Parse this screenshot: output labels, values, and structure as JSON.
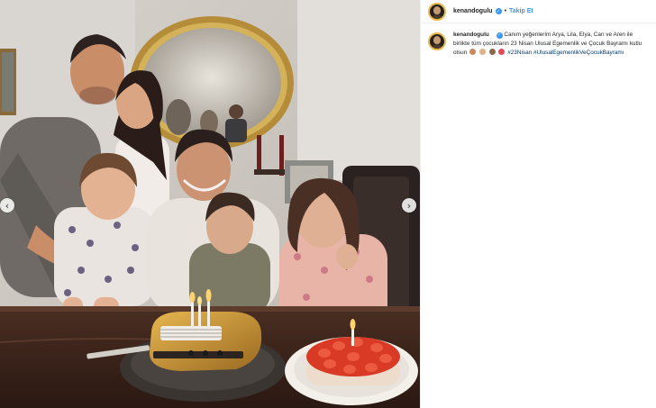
{
  "post": {
    "username": "kenandogulu",
    "follow_label": "Takip Et",
    "separator": "•",
    "caption": {
      "author": "kenandogulu",
      "text": "Canım yeğenlerim Arya, Lila, Elya, Can ve Aren ile birlikte tüm çocukların 23 Nisan Ulusal Egemenlik ve Çocuk Bayramı kutlu olsun",
      "hashtag_1": "#23Nisan",
      "hashtag_2": "#UlusalEgemenlikVeÇocukBayramı"
    }
  },
  "carousel": {
    "prev_icon": "‹",
    "next_icon": "›"
  },
  "colors": {
    "link_blue": "#3897f0",
    "hashtag": "#00376b",
    "verified": "#3897f0",
    "avatar_ring": "#e9b84a"
  },
  "icons": [
    "verified-badge-icon",
    "chevron-left-icon",
    "chevron-right-icon",
    "emoji-icon"
  ]
}
